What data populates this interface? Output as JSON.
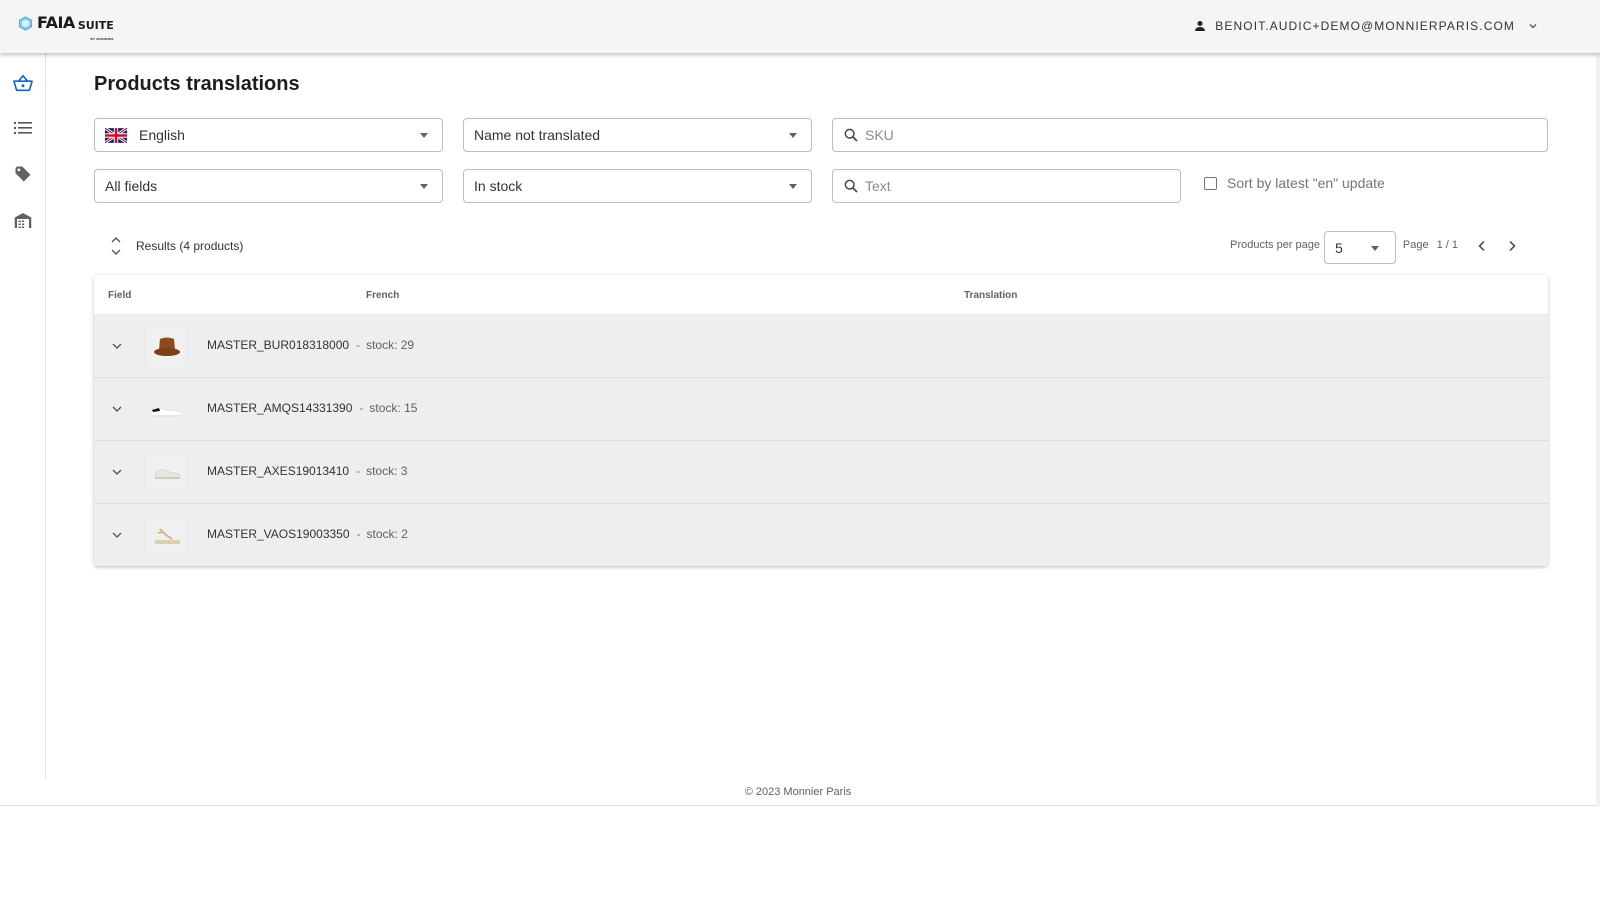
{
  "app": {
    "logo_text": "FAIA",
    "logo_suite": "SUITE",
    "logo_sub": "BY MONNIER",
    "user_email": "BENOIT.AUDIC+DEMO@MONNIERPARIS.COM"
  },
  "sidenav": {
    "items": [
      {
        "icon": "basket-icon",
        "active": true
      },
      {
        "icon": "list-icon",
        "active": false
      },
      {
        "icon": "tag-icon",
        "active": false
      },
      {
        "icon": "warehouse-icon",
        "active": false
      }
    ]
  },
  "page": {
    "title": "Products translations"
  },
  "filters": {
    "language": {
      "value": "English",
      "flag": "uk-flag-icon"
    },
    "translation_status": {
      "value": "Name not translated"
    },
    "sku_search": {
      "placeholder": "SKU",
      "value": ""
    },
    "fields": {
      "value": "All fields"
    },
    "stock": {
      "value": "In stock"
    },
    "text_search": {
      "placeholder": "Text",
      "value": ""
    },
    "sort_checkbox": {
      "label": "Sort by latest \"en\" update",
      "checked": false
    }
  },
  "results": {
    "label": "Results (4 products)",
    "per_page_label": "Products per page",
    "per_page_value": "5",
    "page_label": "Page",
    "page_value": "1 / 1"
  },
  "table": {
    "columns": [
      "Field",
      "French",
      "Translation"
    ],
    "rows": [
      {
        "sku": "MASTER_BUR018318000",
        "separator": "-",
        "stock": "stock: 29",
        "thumb": "bucket-hat"
      },
      {
        "sku": "MASTER_AMQS14331390",
        "separator": "-",
        "stock": "stock: 15",
        "thumb": "white-sneaker"
      },
      {
        "sku": "MASTER_AXES19013410",
        "separator": "-",
        "stock": "stock: 3",
        "thumb": "trainer"
      },
      {
        "sku": "MASTER_VAOS19003350",
        "separator": "-",
        "stock": "stock: 2",
        "thumb": "sandal"
      }
    ]
  },
  "footer": {
    "text": "© 2023 Monnier Paris"
  },
  "colors": {
    "accent": "#1565c0",
    "appbar_bg": "#f5f5f5",
    "row_bg": "#eeeeee"
  }
}
